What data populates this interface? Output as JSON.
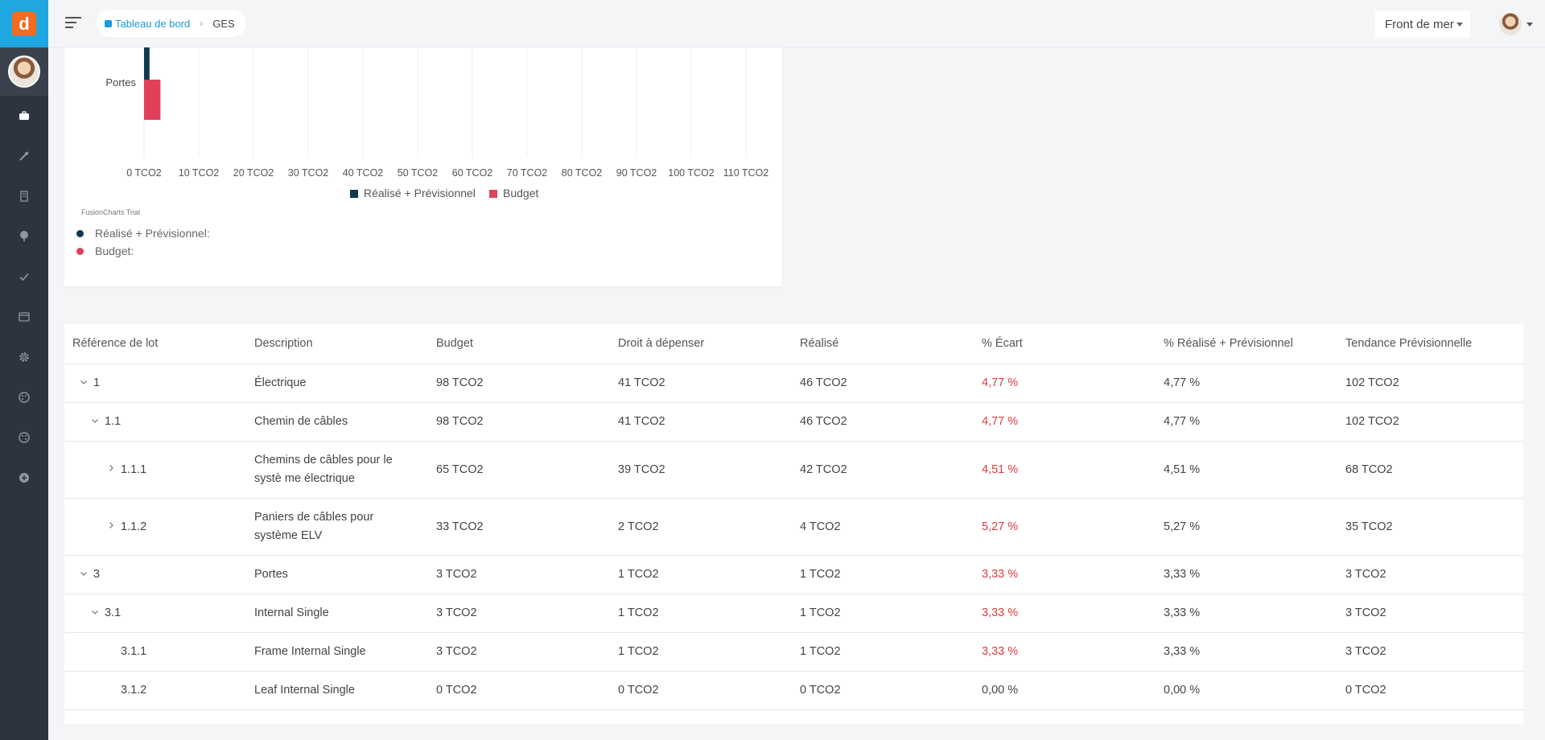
{
  "header": {
    "breadcrumb_home": "Tableau de bord",
    "breadcrumb_current": "GES",
    "site_select": "Front de mer"
  },
  "colors": {
    "realise": "#0c3a4f",
    "budget": "#e0405a",
    "negative": "#e23b3b",
    "accent": "#1a9ad6"
  },
  "sidebar": {
    "items": [
      {
        "icon": "briefcase-icon"
      },
      {
        "icon": "tools-icon"
      },
      {
        "icon": "building-icon"
      },
      {
        "icon": "tree-icon"
      },
      {
        "icon": "check-icon"
      },
      {
        "icon": "window-icon"
      },
      {
        "icon": "gear-icon"
      },
      {
        "icon": "palette-icon"
      },
      {
        "icon": "palette-alt-icon"
      },
      {
        "icon": "plus-circle-icon"
      }
    ]
  },
  "chart_data": {
    "type": "bar",
    "orientation": "horizontal",
    "categories": [
      "Portes"
    ],
    "series": [
      {
        "name": "Réalisé + Prévisionnel",
        "values": [
          1
        ]
      },
      {
        "name": "Budget",
        "values": [
          3
        ]
      }
    ],
    "x_ticks": [
      "0 TCO2",
      "10 TCO2",
      "20 TCO2",
      "30 TCO2",
      "40 TCO2",
      "50 TCO2",
      "60 TCO2",
      "70 TCO2",
      "80 TCO2",
      "90 TCO2",
      "100 TCO2",
      "110 TCO2"
    ],
    "xlim": [
      0,
      110
    ],
    "legend_position": "bottom",
    "trial_label": "FusionCharts Trial",
    "tooltip_rows": [
      "Réalisé + Prévisionnel:",
      "Budget:"
    ]
  },
  "table": {
    "columns": [
      "Référence de lot",
      "Description",
      "Budget",
      "Droit à dépenser",
      "Réalisé",
      "% Écart",
      "% Réalisé + Prévisionnel",
      "Tendance Prévisionnelle"
    ],
    "rows": [
      {
        "ref": "1",
        "level": 0,
        "chevron": "down",
        "desc": "Électrique",
        "budget": "98 TCO2",
        "droit": "41 TCO2",
        "realise": "46 TCO2",
        "ecart": "4,77 %",
        "ecart_neg": true,
        "pct": "4,77 %",
        "tendance": "102 TCO2"
      },
      {
        "ref": "1.1",
        "level": 1,
        "chevron": "down",
        "desc": "Chemin de câbles",
        "budget": "98 TCO2",
        "droit": "41 TCO2",
        "realise": "46 TCO2",
        "ecart": "4,77 %",
        "ecart_neg": true,
        "pct": "4,77 %",
        "tendance": "102 TCO2"
      },
      {
        "ref": "1.1.1",
        "level": 2,
        "chevron": "right",
        "desc": "Chemins de câbles pour le systè me électrique",
        "budget": "65 TCO2",
        "droit": "39 TCO2",
        "realise": "42 TCO2",
        "ecart": "4,51 %",
        "ecart_neg": true,
        "pct": "4,51 %",
        "tendance": "68 TCO2",
        "tall": true
      },
      {
        "ref": "1.1.2",
        "level": 2,
        "chevron": "right",
        "desc": "Paniers de câbles pour système ELV",
        "budget": "33 TCO2",
        "droit": "2 TCO2",
        "realise": "4 TCO2",
        "ecart": "5,27 %",
        "ecart_neg": true,
        "pct": "5,27 %",
        "tendance": "35 TCO2",
        "tall": true
      },
      {
        "ref": "3",
        "level": 0,
        "chevron": "down",
        "desc": "Portes",
        "budget": "3 TCO2",
        "droit": "1 TCO2",
        "realise": "1 TCO2",
        "ecart": "3,33 %",
        "ecart_neg": true,
        "pct": "3,33 %",
        "tendance": "3 TCO2"
      },
      {
        "ref": "3.1",
        "level": 1,
        "chevron": "down",
        "desc": "Internal Single",
        "budget": "3 TCO2",
        "droit": "1 TCO2",
        "realise": "1 TCO2",
        "ecart": "3,33 %",
        "ecart_neg": true,
        "pct": "3,33 %",
        "tendance": "3 TCO2"
      },
      {
        "ref": "3.1.1",
        "level": 2,
        "chevron": "none",
        "desc": "Frame Internal Single",
        "budget": "3 TCO2",
        "droit": "1 TCO2",
        "realise": "1 TCO2",
        "ecart": "3,33 %",
        "ecart_neg": true,
        "pct": "3,33 %",
        "tendance": "3 TCO2"
      },
      {
        "ref": "3.1.2",
        "level": 2,
        "chevron": "none",
        "desc": "Leaf Internal Single",
        "budget": "0 TCO2",
        "droit": "0 TCO2",
        "realise": "0 TCO2",
        "ecart": "0,00 %",
        "ecart_neg": false,
        "pct": "0,00 %",
        "tendance": "0 TCO2"
      }
    ]
  }
}
